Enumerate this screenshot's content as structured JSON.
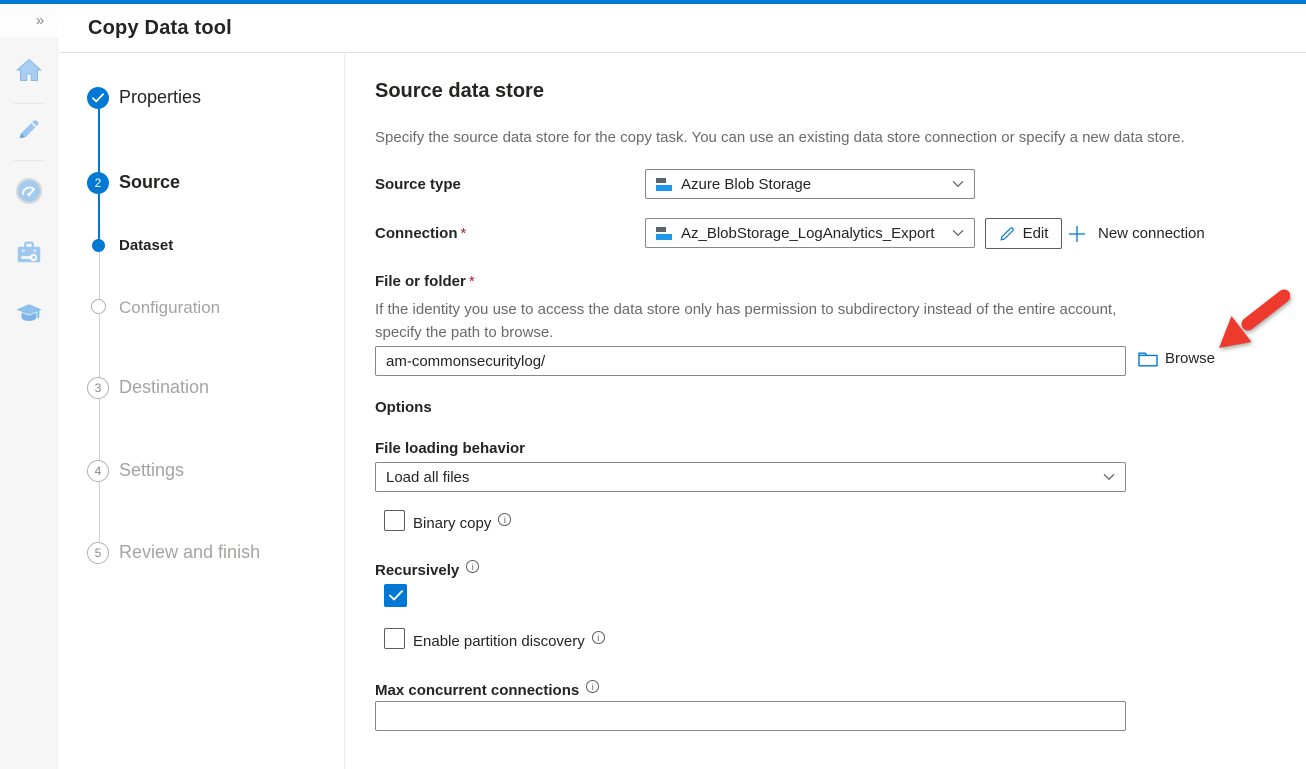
{
  "app": {
    "title": "Copy Data tool"
  },
  "sidebar": {
    "collapse_glyph": "»",
    "icons": [
      "home",
      "author-pencil",
      "monitor-gauge",
      "manage-toolbox",
      "learning-cap"
    ]
  },
  "steps": [
    {
      "label": "Properties",
      "status": "completed",
      "marker": "check"
    },
    {
      "label": "Source",
      "status": "current",
      "number": "2"
    },
    {
      "label": "Dataset",
      "status": "current-substep",
      "marker": "dot"
    },
    {
      "label": "Configuration",
      "status": "upcoming-substep",
      "marker": "ring"
    },
    {
      "label": "Destination",
      "status": "upcoming",
      "number": "3"
    },
    {
      "label": "Settings",
      "status": "upcoming",
      "number": "4"
    },
    {
      "label": "Review and finish",
      "status": "upcoming",
      "number": "5"
    }
  ],
  "main": {
    "heading": "Source data store",
    "description": "Specify the source data store for the copy task. You can use an existing data store connection or specify a new data store.",
    "source_type": {
      "label": "Source type",
      "value": "Azure Blob Storage",
      "icon": "azure-blob-storage-icon"
    },
    "connection": {
      "label": "Connection",
      "required_marker": "*",
      "value": "Az_BlobStorage_LogAnalytics_Export",
      "icon": "azure-blob-storage-icon",
      "edit_label": "Edit",
      "new_connection_label": "New connection"
    },
    "file_or_folder": {
      "label": "File or folder",
      "required_marker": "*",
      "help": "If the identity you use to access the data store only has permission to subdirectory instead of the entire account, specify the path to browse.",
      "value": "am-commonsecuritylog/",
      "browse_label": "Browse"
    },
    "options": {
      "heading": "Options",
      "file_loading_behavior": {
        "label": "File loading behavior",
        "value": "Load all files"
      },
      "binary_copy": {
        "label": "Binary copy",
        "checked": false
      },
      "recursively": {
        "label": "Recursively",
        "checked": true
      },
      "partition_discovery": {
        "label": "Enable partition discovery",
        "checked": false
      },
      "max_concurrent": {
        "label": "Max concurrent connections",
        "value": ""
      }
    }
  },
  "colors": {
    "accent": "#0078d4",
    "annotation_red": "#ee3a2c",
    "required_red": "#a4262c"
  }
}
